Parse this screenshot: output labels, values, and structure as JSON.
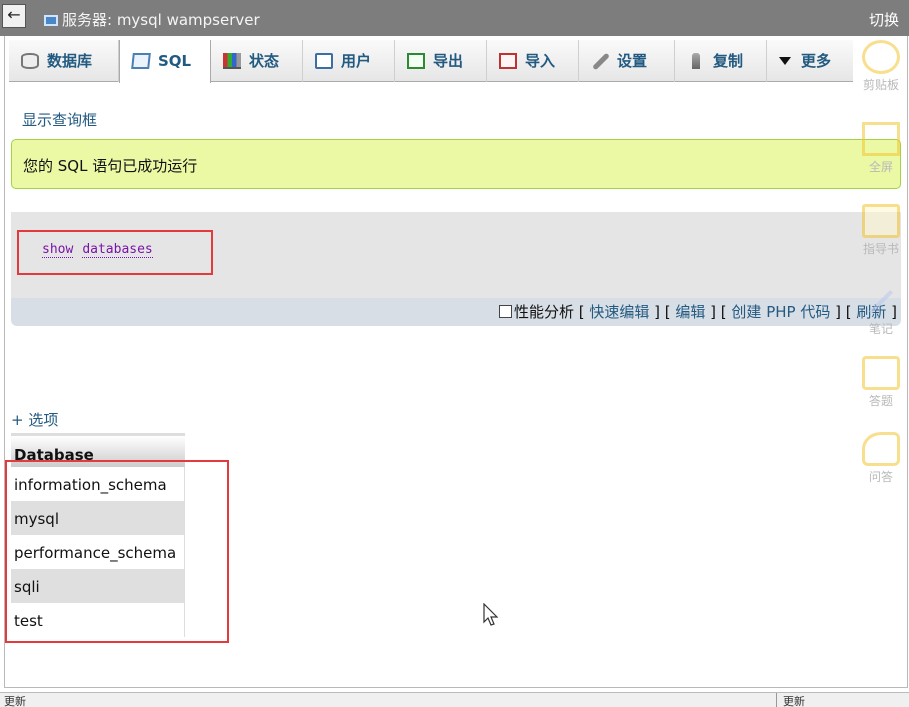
{
  "window": {
    "back_label": "←",
    "title": "服务器: mysql wampserver",
    "switch_label": "切换"
  },
  "tabs": [
    {
      "label": "数据库",
      "icon": "database-icon"
    },
    {
      "label": "SQL",
      "icon": "sql-icon",
      "active": true
    },
    {
      "label": "状态",
      "icon": "status-icon"
    },
    {
      "label": "用户",
      "icon": "users-icon"
    },
    {
      "label": "导出",
      "icon": "export-icon"
    },
    {
      "label": "导入",
      "icon": "import-icon"
    },
    {
      "label": "设置",
      "icon": "settings-icon"
    },
    {
      "label": "复制",
      "icon": "replication-icon"
    },
    {
      "label": "更多",
      "icon": "chevron-down-icon"
    }
  ],
  "show_query_box": "显示查询框",
  "success_message": "您的 SQL 语句已成功运行",
  "sql": {
    "keyword1": "show",
    "keyword2": "databases"
  },
  "tools": {
    "profiling": "性能分析",
    "inline_edit": "快速编辑",
    "edit": "编辑",
    "create_php": "创建 PHP 代码",
    "refresh": "刷新"
  },
  "options_label": "+ 选项",
  "results": {
    "header": "Database",
    "rows": [
      "information_schema",
      "mysql",
      "performance_schema",
      "sqli",
      "test"
    ]
  },
  "side_panel": [
    "剪贴板",
    "全屏",
    "指导书",
    "笔记",
    "答题",
    "问答"
  ],
  "statusbar": {
    "left": "更新",
    "right": "更新"
  },
  "colors": {
    "link": "#235a81",
    "success_bg": "#ebf8a4",
    "highlight": "#e23a3d",
    "sql_keyword": "#7a13a9"
  }
}
